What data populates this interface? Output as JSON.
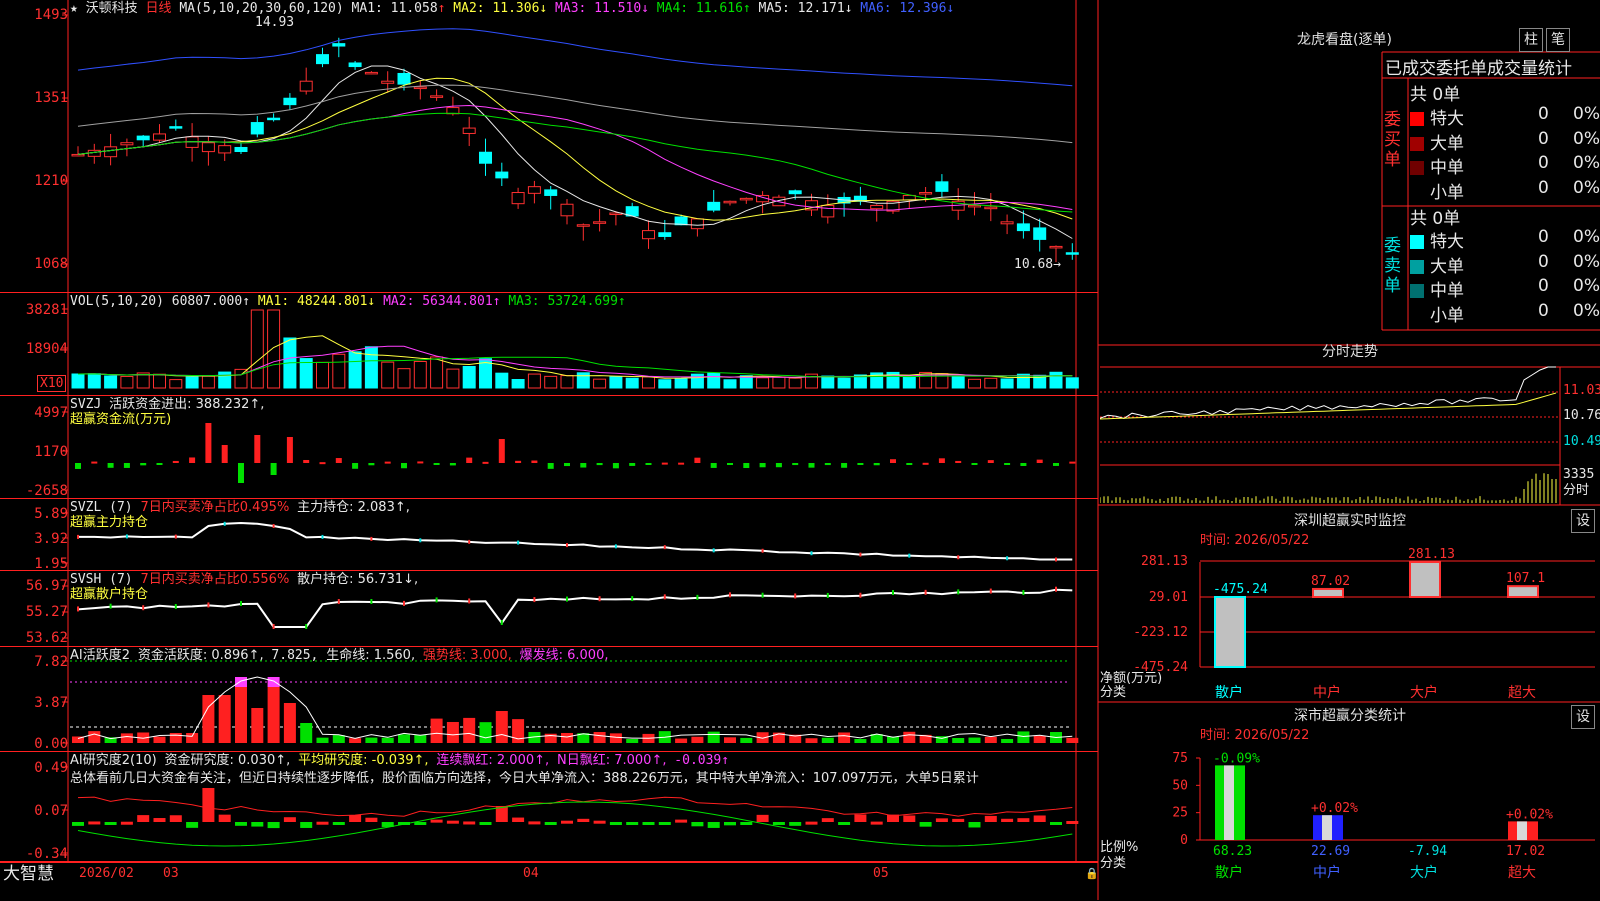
{
  "title_bar": {
    "star": "★",
    "stock_name": "沃顿科技",
    "period": "日线",
    "ma_label": "MA(5,10,20,30,60,120)",
    "ma1": "MA1: 11.058",
    "ma2": "MA2: 11.306↓",
    "ma3": "MA3: 11.510↓",
    "ma4": "MA4: 11.616↑",
    "ma5": "MA5: 12.171↓",
    "ma6": "MA6: 12.396↓",
    "ma1_arrow": "↑"
  },
  "price_axis": [
    "14.93",
    "13.51",
    "12.10",
    "10.68"
  ],
  "price_axis_display": [
    "1493",
    "1351",
    "1210",
    "1068"
  ],
  "price_high_label": "14.93",
  "price_low_label": "10.68→",
  "vol": {
    "label": "VOL(5,10,20)",
    "value": "60807.000↑",
    "ma1": "MA1: 48244.801↓",
    "ma2": "MA2: 56344.801↑",
    "ma3": "MA3: 53724.699↑",
    "axis": [
      "38281",
      "18904"
    ],
    "unit": "X10"
  },
  "svzj": {
    "label": "SVZJ",
    "desc": "活跃资金进出: 388.232↑,",
    "sub": "超赢资金流(万元)",
    "axis": [
      "4997",
      "1170",
      "-2658"
    ]
  },
  "svzl": {
    "label": "SVZL (7)",
    "desc": "7日内买卖净占比0.495%",
    "main": "主力持仓: 2.083↑,",
    "sub": "超赢主力持仓",
    "axis": [
      "5.89",
      "3.92",
      "1.95"
    ]
  },
  "svsh": {
    "label": "SVSH (7)",
    "desc": "7日内买卖净占比0.556%",
    "main": "散户持仓: 56.731↓,",
    "sub": "超赢散户持仓",
    "axis": [
      "56.97",
      "55.27",
      "53.62"
    ]
  },
  "ai2": {
    "label": "AI活跃度2",
    "a": "资金活跃度: 0.896↑,",
    "b": "7.825,",
    "c": "生命线: 1.560,",
    "d": "强势线: 3.000,",
    "e": "爆发线: 6.000,",
    "axis": [
      "7.82",
      "3.87",
      "0.00"
    ]
  },
  "ai_r": {
    "label": "AI研究度2(10)",
    "a": "资金研究度: 0.030↑,",
    "b": "平均研究度: -0.039↑,",
    "c": "连续飘红: 2.000↑,",
    "d": "N日飘红: 7.000↑,",
    "e": "-0.039↑",
    "axis": [
      "0.49",
      "0.07",
      "-0.34"
    ],
    "summary": "总体看前几日大资金有关注，但近日持续性逐步降低，股价面临方向选择，今日大单净流入：388.226万元，其中特大单净流入：107.097万元，大单5日累计"
  },
  "dates": {
    "logo": "大智慧",
    "d1": "2026/02",
    "d2": "03",
    "d3": "04",
    "d4": "05"
  },
  "lhb": {
    "title": "龙虎看盘(逐单)",
    "btn1": "柱",
    "btn2": "笔",
    "header": "已成交委托单成交量统计",
    "buy": {
      "label": "委买单",
      "total": "共 0单",
      "rows": [
        {
          "name": "特大",
          "num": "0",
          "pct": "0%",
          "color": "#ff0000"
        },
        {
          "name": "大单",
          "num": "0",
          "pct": "0%",
          "color": "#a00000"
        },
        {
          "name": "中单",
          "num": "0",
          "pct": "0%",
          "color": "#700000"
        },
        {
          "name": "小单",
          "num": "0",
          "pct": "0%",
          "color": ""
        }
      ]
    },
    "sell": {
      "label": "委卖单",
      "total": "共 0单",
      "rows": [
        {
          "name": "特大",
          "num": "0",
          "pct": "0%",
          "color": "#00ffff"
        },
        {
          "name": "大单",
          "num": "0",
          "pct": "0%",
          "color": "#00a0a0"
        },
        {
          "name": "中单",
          "num": "0",
          "pct": "0%",
          "color": "#007070"
        },
        {
          "name": "小单",
          "num": "0",
          "pct": "0%",
          "color": ""
        }
      ]
    }
  },
  "fenshi": {
    "title": "分时走势",
    "axis": [
      "11.03",
      "10.76",
      "10.49"
    ],
    "vol_axis": "3335",
    "vol_unit": "分时"
  },
  "monitor": {
    "title": "深圳超赢实时监控",
    "btn": "设",
    "time": "时间: 2026/05/22",
    "axis": [
      "281.13",
      "29.01",
      "-223.12",
      "-475.24"
    ],
    "ylabel": "净额(万元)",
    "xlabel": "分类",
    "chart_data": {
      "type": "bar",
      "categories": [
        "散户",
        "中户",
        "大户",
        "超大"
      ],
      "values": [
        -475.24,
        87.02,
        281.13,
        107.1
      ],
      "value_labels": [
        "-475.24",
        "87.02",
        "281.13",
        "107.1"
      ],
      "ylim": [
        -475.24,
        281.13
      ],
      "ylabel": "净额(万元)",
      "xlabel": "分类"
    }
  },
  "classify": {
    "title": "深市超赢分类统计",
    "btn": "设",
    "time": "时间: 2026/05/22",
    "axis": [
      "75",
      "50",
      "25",
      "0"
    ],
    "ylabel": "比例%",
    "xlabel": "分类",
    "chart_data": {
      "type": "bar",
      "categories": [
        "散户",
        "中户",
        "大户",
        "超大"
      ],
      "values": [
        68.23,
        22.69,
        -7.94,
        17.02
      ],
      "top_labels": [
        "-0.09%",
        "+0.02%",
        "",
        "+0.02%"
      ],
      "bottom_labels": [
        "68.23",
        "22.69",
        "-7.94",
        "17.02"
      ],
      "ylim": [
        0,
        75
      ],
      "ylabel": "比例%",
      "xlabel": "分类"
    }
  }
}
